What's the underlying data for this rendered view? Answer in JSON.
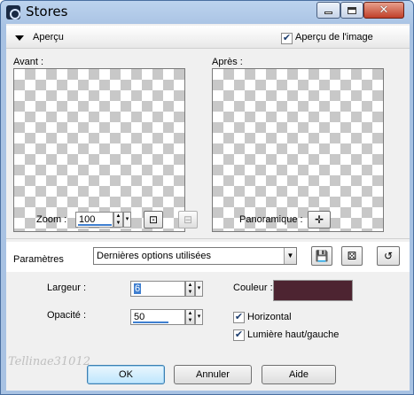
{
  "window": {
    "title": "Stores"
  },
  "preview": {
    "section_title": "Aperçu",
    "preview_checkbox_label": "Aperçu de l'image",
    "preview_checked": true,
    "before_label": "Avant :",
    "after_label": "Après :"
  },
  "zoom": {
    "label": "Zoom :",
    "value": "100"
  },
  "pan": {
    "label": "Panoramique :"
  },
  "params": {
    "label": "Paramètres",
    "preset": "Dernières options utilisées"
  },
  "settings": {
    "width_label": "Largeur :",
    "width_value": "6",
    "opacity_label": "Opacité :",
    "opacity_value": "50",
    "color_label": "Couleur :",
    "color_value": "#4d2431",
    "horizontal_label": "Horizontal",
    "horizontal_checked": true,
    "light_label": "Lumière haut/gauche",
    "light_checked": true
  },
  "buttons": {
    "ok": "OK",
    "cancel": "Annuler",
    "help": "Aide"
  },
  "watermark": "Tellinae31012"
}
